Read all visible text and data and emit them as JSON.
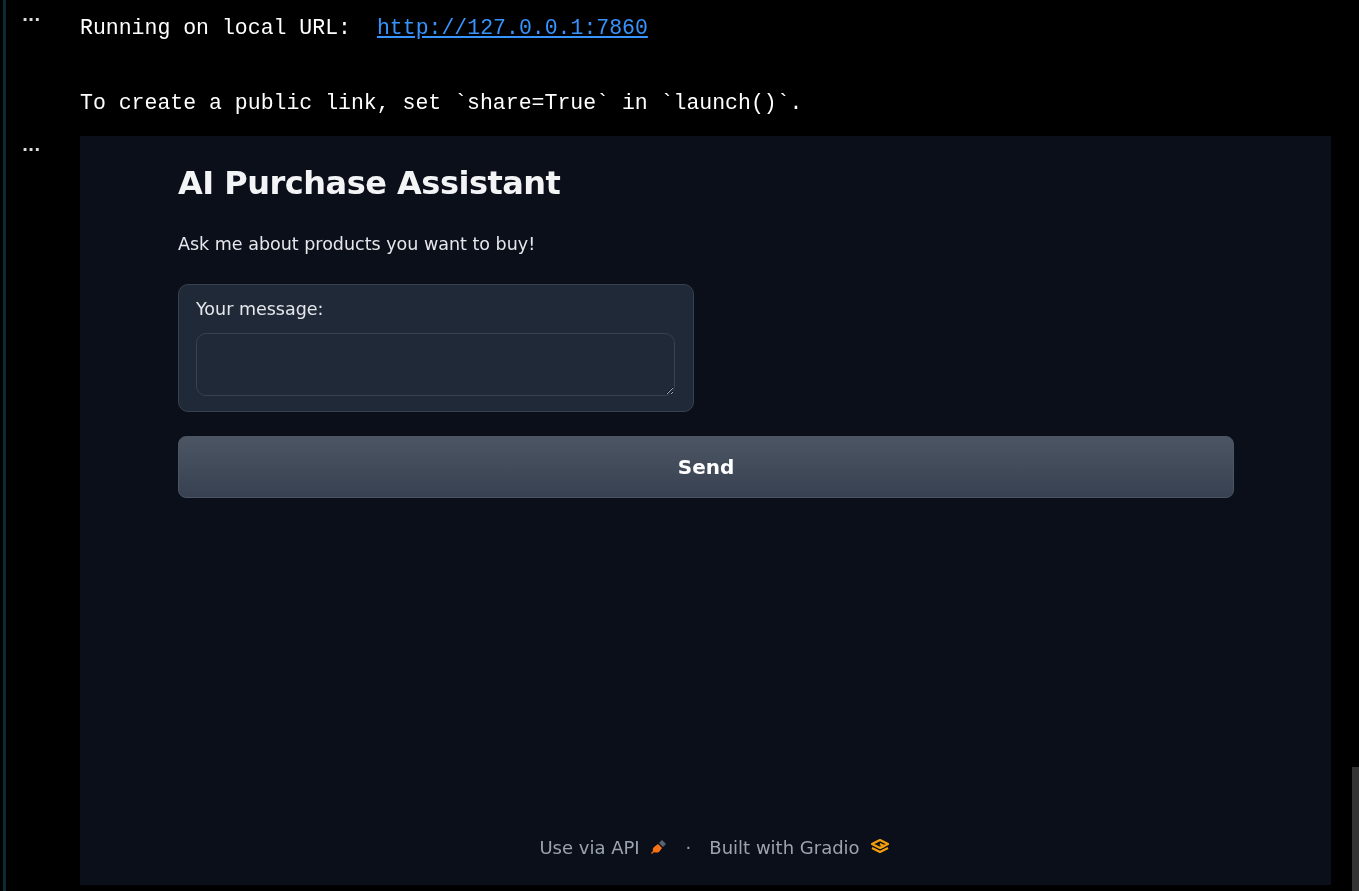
{
  "cells": [
    {
      "prompt": "···",
      "lines": [
        {
          "text": "Running on local URL:",
          "link": "http://127.0.0.1:7860"
        },
        {
          "text": "To create a public link, set `share=True` in `launch()`."
        }
      ]
    },
    {
      "prompt": "···",
      "app": {
        "title": "AI Purchase Assistant",
        "description": "Ask me about products you want to buy!",
        "textbox": {
          "label": "Your message:"
        },
        "button": "Send",
        "footer": {
          "api_link": "Use via API",
          "separator": "·",
          "built_with": "Built with Gradio"
        }
      }
    }
  ]
}
